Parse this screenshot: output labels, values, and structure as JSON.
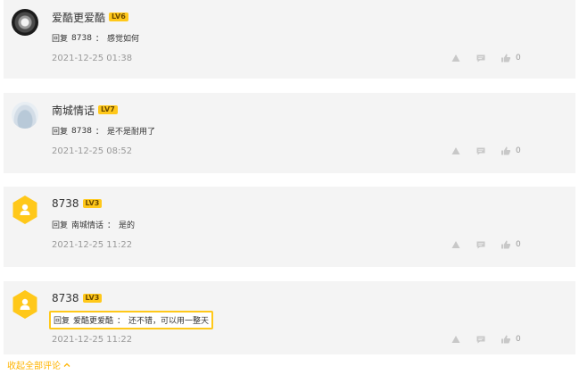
{
  "comments": [
    {
      "username": "爱酷更爱酷",
      "level": "LV6",
      "reply_prefix": "回复",
      "reply_to": "8738",
      "separator": "：",
      "text": "感觉如何",
      "time": "2021-12-25 01:38",
      "like_count": "0",
      "avatar": "photo-avatar"
    },
    {
      "username": "南城情话",
      "level": "LV7",
      "reply_prefix": "回复",
      "reply_to": "8738",
      "separator": "：",
      "text": "是不是耐用了",
      "time": "2021-12-25 08:52",
      "like_count": "0",
      "avatar": "cloud-avatar"
    },
    {
      "username": "8738",
      "level": "LV3",
      "reply_prefix": "回复",
      "reply_to": "南城情话",
      "separator": "：",
      "text": "是的",
      "time": "2021-12-25 11:22",
      "like_count": "0",
      "avatar": "default-user-hexagon-avatar"
    },
    {
      "username": "8738",
      "level": "LV3",
      "reply_prefix": "回复",
      "reply_to": "爱酷更爱酷",
      "separator": "：",
      "text": "还不错，可以用一整天",
      "time": "2021-12-25 11:22",
      "like_count": "0",
      "avatar": "default-user-hexagon-avatar",
      "highlighted": true
    }
  ],
  "collapse_label": "收起全部评论",
  "colors": {
    "accent": "#ffb400",
    "level_badge": "#ffc81a",
    "card_bg": "#f4f4f4",
    "muted_text": "#999999"
  },
  "icons": [
    "warning-icon",
    "comment-icon",
    "thumbs-up-icon",
    "chevron-up-icon"
  ]
}
